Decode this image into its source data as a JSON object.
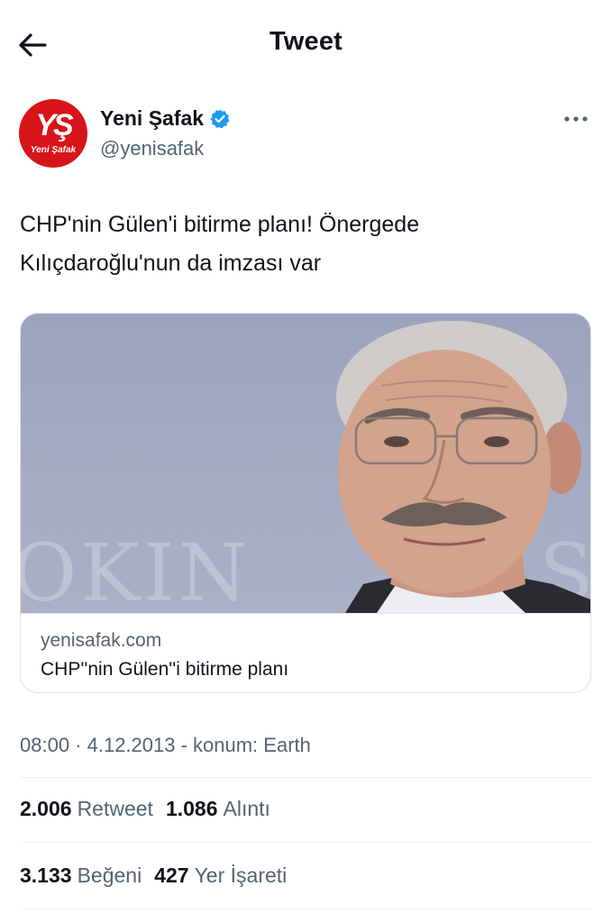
{
  "header": {
    "title": "Tweet",
    "back_icon": "arrow-left-icon"
  },
  "author": {
    "name": "Yeni Şafak",
    "handle": "@yenisafak",
    "avatar_logo": "YŞ",
    "avatar_subtext": "Yeni Şafak",
    "avatar_color": "#d7141a",
    "verified_color": "#1d9bf0",
    "more_icon": "more-horizontal-icon"
  },
  "tweet": {
    "text_line1": "CHP'nin Gülen'i bitirme planı! Önergede",
    "text_line2": "Kılıçdaroğlu'nun da imzası var"
  },
  "card": {
    "image_alt": "photo",
    "domain": "yenisafak.com",
    "title": "CHP''nin Gülen''i bitirme planı"
  },
  "timestamp": "08:00 · 4.12.2013 - konum: Earth",
  "stats": {
    "retweets": {
      "count": "2.006",
      "label": "Retweet"
    },
    "quotes": {
      "count": "1.086",
      "label": "Alıntı"
    },
    "likes": {
      "count": "3.133",
      "label": "Beğeni"
    },
    "bookmarks": {
      "count": "427",
      "label": "Yer İşareti"
    }
  }
}
